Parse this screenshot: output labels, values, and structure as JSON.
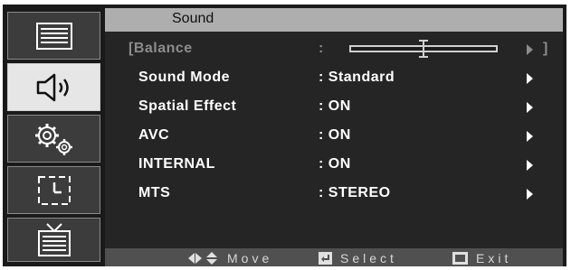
{
  "menu": {
    "title": "Sound",
    "sidebar": [
      {
        "icon": "picture-icon",
        "active": false
      },
      {
        "icon": "speaker-icon",
        "active": true
      },
      {
        "icon": "gears-icon",
        "active": false
      },
      {
        "icon": "clock-icon",
        "active": false
      },
      {
        "icon": "tv-icon",
        "active": false
      }
    ],
    "items": [
      {
        "label": "Balance",
        "separator": ":",
        "value": "",
        "level": 0.5
      },
      {
        "label": "Sound Mode",
        "value": ": Standard"
      },
      {
        "label": "Spatial Effect",
        "value": ": ON"
      },
      {
        "label": "AVC",
        "value": ": ON"
      },
      {
        "label": "INTERNAL",
        "value": ": ON"
      },
      {
        "label": "MTS",
        "value": ": STEREO"
      }
    ],
    "balance_open_bracket": "[",
    "balance_close_bracket": "]"
  },
  "footer": {
    "move_label": "Move",
    "select_label": "Select",
    "exit_label": "Exit"
  },
  "colors": {
    "frame": "#1a1a1a",
    "header": "#aeaeae",
    "panel": "#252525",
    "footer": "#505050",
    "active_sidebar": "#e6e6e6"
  }
}
